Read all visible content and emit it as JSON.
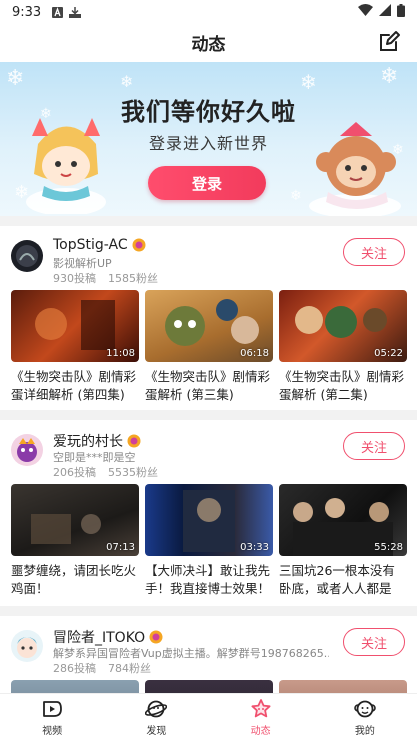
{
  "status_bar": {
    "time": "9:33"
  },
  "header": {
    "title": "动态"
  },
  "banner": {
    "title": "我们等你好久啦",
    "subtitle": "登录进入新世界",
    "login_label": "登录"
  },
  "feed": [
    {
      "name": "TopStig-AC",
      "desc": "影视解析UP",
      "posts": "930投稿",
      "fans": "1585粉丝",
      "follow_label": "关注",
      "videos": [
        {
          "title": "《生物突击队》剧情彩蛋详细解析 (第四集)",
          "duration": "11:08"
        },
        {
          "title": "《生物突击队》剧情彩蛋解析 (第三集)",
          "duration": "06:18"
        },
        {
          "title": "《生物突击队》剧情彩蛋解析 (第二集)",
          "duration": "05:22"
        }
      ]
    },
    {
      "name": "爱玩的村长",
      "desc": "空即是***即是空",
      "posts": "206投稿",
      "fans": "5535粉丝",
      "follow_label": "关注",
      "videos": [
        {
          "title": "噩梦缠绕，请团长吃火鸡面！",
          "duration": "07:13"
        },
        {
          "title": "【大师决斗】敢让我先手！我直接博士效果！",
          "duration": "03:33"
        },
        {
          "title": "三国坑26一根本没有卧底，或者人人都是卧...",
          "duration": "55:28"
        }
      ]
    },
    {
      "name": "冒险者_ITOKO",
      "desc": "解梦系异国冒险者Vup虚拟主播。解梦群号198768265...",
      "posts": "286投稿",
      "fans": "784粉丝",
      "follow_label": "关注"
    }
  ],
  "bottom_nav": [
    {
      "label": "视频",
      "icon": "video-icon"
    },
    {
      "label": "发现",
      "icon": "planet-icon"
    },
    {
      "label": "动态",
      "icon": "star-icon",
      "active": true
    },
    {
      "label": "我的",
      "icon": "monkey-icon"
    }
  ],
  "colors": {
    "accent": "#f0506e",
    "banner_button": "#f23b5c",
    "badge": "#f5a623"
  }
}
